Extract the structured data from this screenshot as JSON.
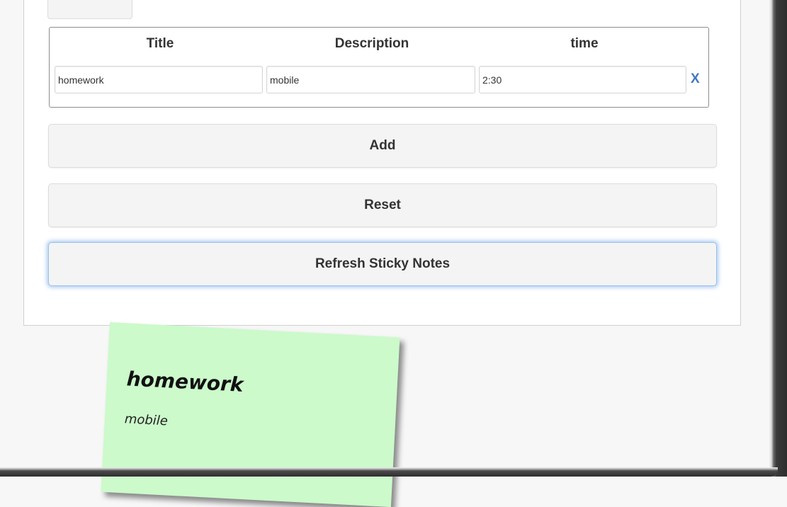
{
  "form": {
    "headers": {
      "title": "Title",
      "description": "Description",
      "time": "time"
    },
    "row": {
      "title": "homework",
      "description": "mobile",
      "time": "2:30",
      "remove_label": "X"
    }
  },
  "buttons": {
    "add": "Add",
    "reset": "Reset",
    "refresh": "Refresh Sticky Notes"
  },
  "sticky_notes": [
    {
      "title": "homework",
      "body": "mobile",
      "color": "#ccfacb"
    }
  ],
  "colors": {
    "remove_x": "#3f78c2",
    "button_bg": "#f4f4f4",
    "focus_glow": "#66a0e6"
  }
}
